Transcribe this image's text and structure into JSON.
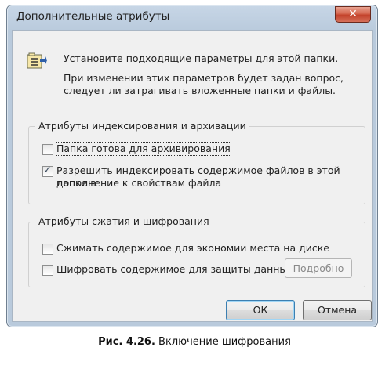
{
  "window": {
    "title": "Дополнительные атрибуты",
    "close_glyph": "✕"
  },
  "info": {
    "line1": "Установите подходящие параметры для этой папки.",
    "line2a": "При изменении этих параметров будет задан вопрос,",
    "line2b": "следует ли затрагивать вложенные папки и файлы."
  },
  "group_index": {
    "title": "Атрибуты индексирования и архивации",
    "archive": {
      "label": "Папка готова для архивирования",
      "checked": false
    },
    "index": {
      "label_line1": "Разрешить индексировать содержимое файлов в этой папке в",
      "label_line2": "дополнение к свойствам файла",
      "checked": true
    }
  },
  "group_compress": {
    "title": "Атрибуты сжатия и шифрования",
    "compress": {
      "label": "Сжимать содержимое для экономии места на диске",
      "checked": false
    },
    "encrypt": {
      "label": "Шифровать содержимое для защиты данных",
      "checked": false
    },
    "details_label": "Подробно"
  },
  "buttons": {
    "ok": "ОК",
    "cancel": "Отмена"
  },
  "caption": {
    "label": "Рис. 4.26.",
    "text": " Включение шифрования"
  },
  "icons": {
    "folder": "folder-attributes-icon",
    "checkmark": "✓"
  }
}
